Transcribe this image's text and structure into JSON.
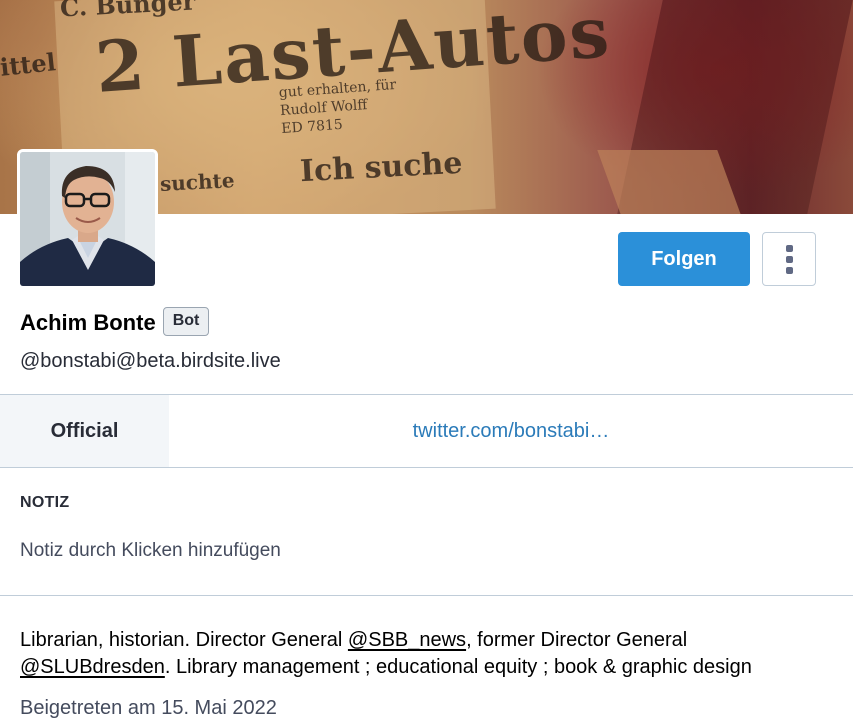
{
  "header": {
    "image_texts": {
      "headline": "2 Last-Autos",
      "subheadline": "Ich suche",
      "small": "suchte",
      "top": "C. Bünger",
      "side": "ittel",
      "lines": [
        "gut erhalten, für",
        "Rudolf Wolff",
        "ED 7815"
      ]
    }
  },
  "profile": {
    "display_name": "Achim Bonte",
    "bot_badge": "Bot",
    "handle": "@bonstabi@beta.birdsite.live",
    "follow_label": "Folgen"
  },
  "fields": [
    {
      "name": "Official",
      "value": "twitter.com/bonstabi…"
    }
  ],
  "note": {
    "label": "NOTIZ",
    "placeholder": "Notiz durch Klicken hinzufügen"
  },
  "bio": {
    "text_1": "Librarian, historian. Director General ",
    "mention_1": "@SBB_news",
    "text_2": ", former Director General ",
    "mention_2": "@SLUBdresden",
    "text_3": ". Library management ; educational equity ; book & graphic design"
  },
  "joined": "Beigetreten am 15. Mai 2022",
  "colors": {
    "accent": "#2b90d9",
    "link": "#2b7bb9",
    "border": "#c0cdd9"
  },
  "icons": {
    "menu": "vertical-ellipsis-icon"
  }
}
